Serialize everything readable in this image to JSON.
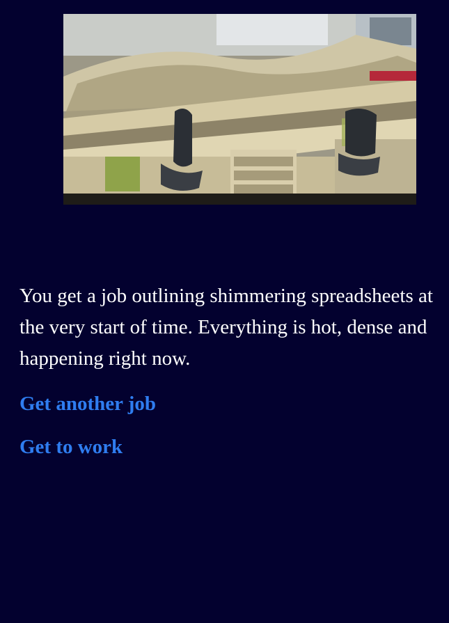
{
  "image": {
    "icon": "office-cubicles-image"
  },
  "story": {
    "text": "You get a job outlining shimmering spreadsheets at the very start of time. Everything is hot, dense and happening right now."
  },
  "choices": [
    {
      "label": "Get another job"
    },
    {
      "label": "Get to work"
    }
  ],
  "colors": {
    "background": "#03012f",
    "text": "#ffffff",
    "link": "#2f7df0"
  }
}
